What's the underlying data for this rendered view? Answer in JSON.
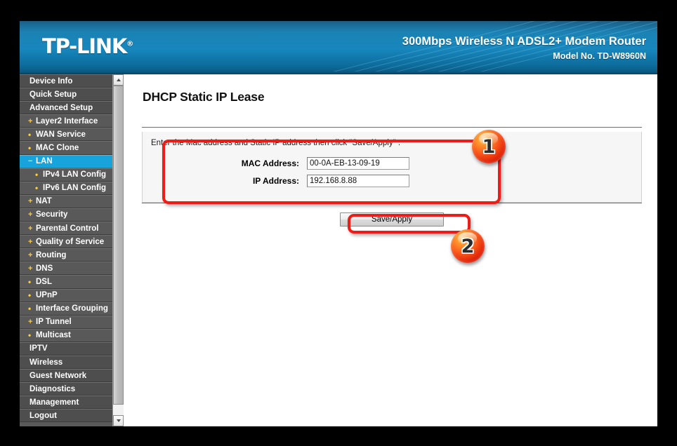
{
  "header": {
    "logo": "TP-LINK",
    "logo_mark": "®",
    "product_title": "300Mbps Wireless N ADSL2+ Modem Router",
    "model_label": "Model No. TD-W8960N"
  },
  "sidebar": {
    "items": [
      {
        "label": "Device Info",
        "marker": "",
        "level": "top",
        "active": false
      },
      {
        "label": "Quick Setup",
        "marker": "",
        "level": "top",
        "active": false
      },
      {
        "label": "Advanced Setup",
        "marker": "",
        "level": "top",
        "active": false
      },
      {
        "label": "Layer2 Interface",
        "marker": "+",
        "level": "sub",
        "active": false
      },
      {
        "label": "WAN Service",
        "marker": "•",
        "level": "sub",
        "active": false
      },
      {
        "label": "MAC Clone",
        "marker": "•",
        "level": "sub",
        "active": false
      },
      {
        "label": "LAN",
        "marker": "−",
        "level": "sub",
        "active": true
      },
      {
        "label": "IPv4 LAN Config",
        "marker": "•",
        "level": "sub2",
        "active": false
      },
      {
        "label": "IPv6 LAN Config",
        "marker": "•",
        "level": "sub2",
        "active": false
      },
      {
        "label": "NAT",
        "marker": "+",
        "level": "sub",
        "active": false
      },
      {
        "label": "Security",
        "marker": "+",
        "level": "sub",
        "active": false
      },
      {
        "label": "Parental Control",
        "marker": "+",
        "level": "sub",
        "active": false
      },
      {
        "label": "Quality of Service",
        "marker": "+",
        "level": "sub",
        "active": false
      },
      {
        "label": "Routing",
        "marker": "+",
        "level": "sub",
        "active": false
      },
      {
        "label": "DNS",
        "marker": "+",
        "level": "sub",
        "active": false
      },
      {
        "label": "DSL",
        "marker": "•",
        "level": "sub",
        "active": false
      },
      {
        "label": "UPnP",
        "marker": "•",
        "level": "sub",
        "active": false
      },
      {
        "label": "Interface Grouping",
        "marker": "•",
        "level": "sub",
        "active": false
      },
      {
        "label": "IP Tunnel",
        "marker": "+",
        "level": "sub",
        "active": false
      },
      {
        "label": "Multicast",
        "marker": "•",
        "level": "sub",
        "active": false
      },
      {
        "label": "IPTV",
        "marker": "",
        "level": "top",
        "active": false
      },
      {
        "label": "Wireless",
        "marker": "",
        "level": "top",
        "active": false
      },
      {
        "label": "Guest Network",
        "marker": "",
        "level": "top",
        "active": false
      },
      {
        "label": "Diagnostics",
        "marker": "",
        "level": "top",
        "active": false
      },
      {
        "label": "Management",
        "marker": "",
        "level": "top",
        "active": false
      },
      {
        "label": "Logout",
        "marker": "",
        "level": "top",
        "active": false
      }
    ]
  },
  "main": {
    "page_title": "DHCP Static IP Lease",
    "note": "Enter the Mac address and Static IP address then click \"Save/Apply\" .",
    "fields": [
      {
        "label": "MAC Address:",
        "value": "00-0A-EB-13-09-19"
      },
      {
        "label": "IP Address:",
        "value": "192.168.8.88"
      }
    ],
    "save_button": "Save/Apply"
  },
  "annotations": {
    "badges": [
      {
        "number": "1"
      },
      {
        "number": "2"
      }
    ],
    "highlight_color": "#ee1c16",
    "badge_color": "#f8561a"
  }
}
